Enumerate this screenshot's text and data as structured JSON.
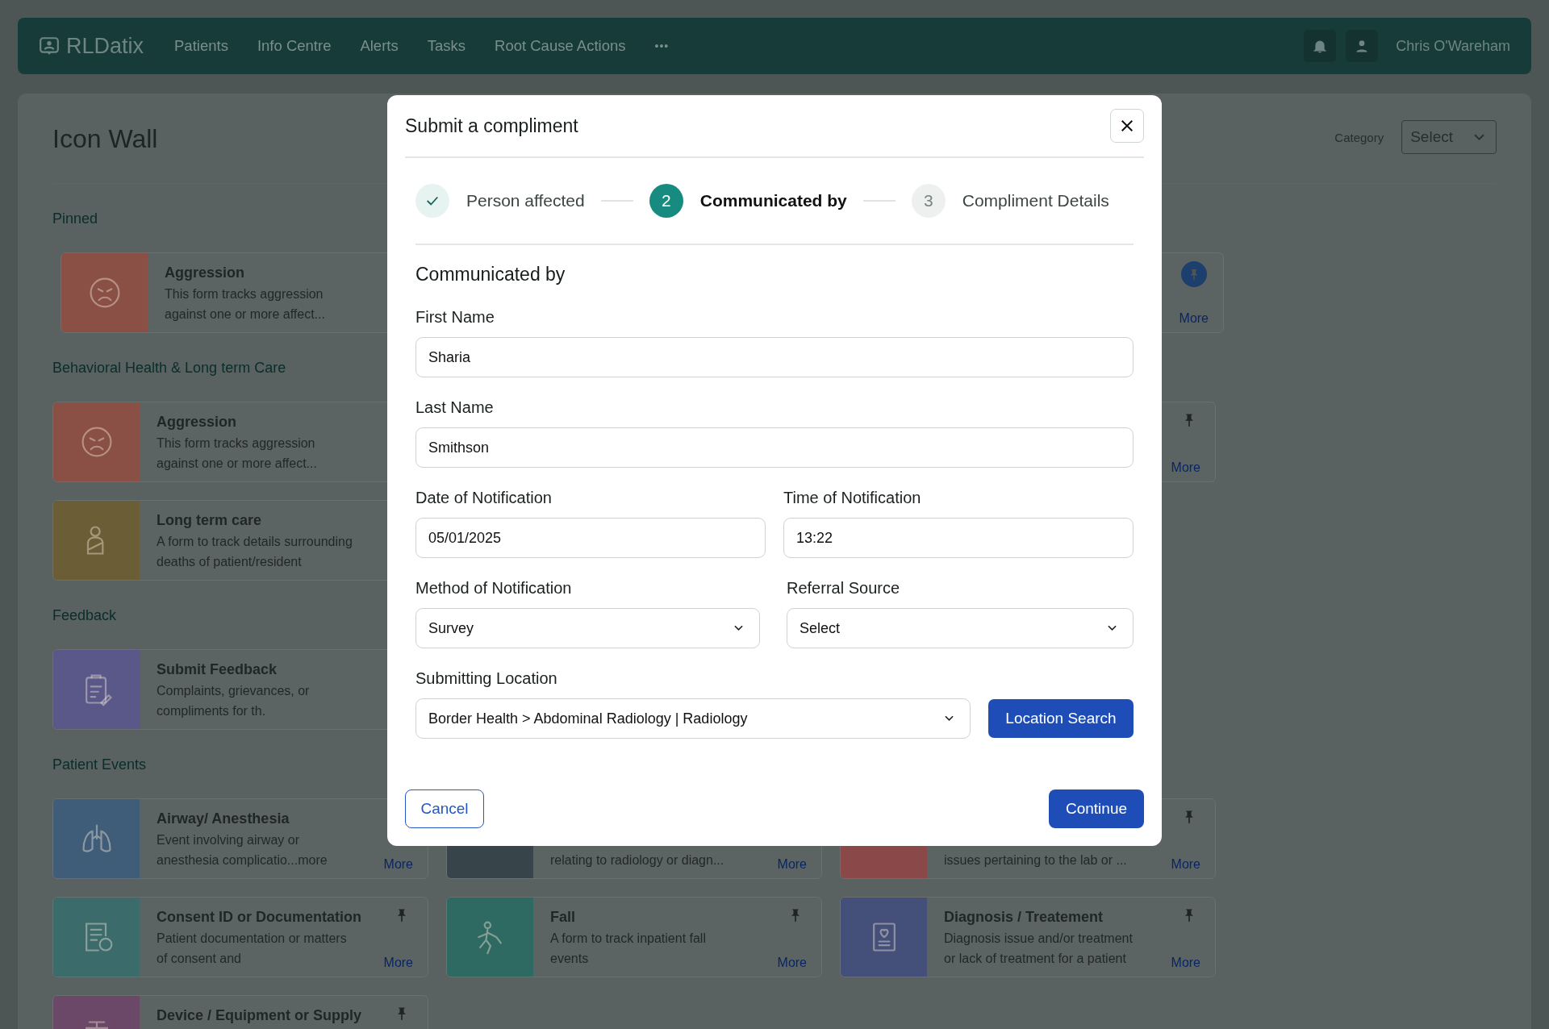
{
  "nav": {
    "brand": "RLDatix",
    "items": [
      "Patients",
      "Info Centre",
      "Alerts",
      "Tasks",
      "Root Cause Actions"
    ],
    "more": "•••",
    "user": "Chris O'Wareham"
  },
  "page": {
    "title": "Icon Wall",
    "category_label": "Category",
    "category_select": "Select",
    "sections": [
      {
        "title": "Pinned",
        "kind": "pinned",
        "cards": [
          {
            "title": "Aggression",
            "description": [
              "This form tracks aggression",
              "against one or more affect..."
            ],
            "color": "#8a4f45"
          },
          {
            "pinned": true,
            "more": "More"
          }
        ]
      },
      {
        "title": "Behavioral Health & Long term Care",
        "kind": "category",
        "cards": [
          {
            "title": "Aggression",
            "description": [
              "This form tracks aggression",
              "against one or more affect..."
            ],
            "color": "#8a4f45"
          },
          {
            "pinned": false,
            "more": "More"
          },
          {
            "title": "Long term care",
            "description": [
              "A form to track details surrounding",
              "deaths of patient/resident"
            ],
            "color": "#6b5e36"
          }
        ]
      },
      {
        "title": "Feedback",
        "kind": "category",
        "cards": [
          {
            "title": "Submit Feedback",
            "description": [
              "Complaints, grievances, or",
              "compliments for th."
            ],
            "color": "#5a5889"
          }
        ]
      },
      {
        "title": "Patient Events",
        "kind": "category",
        "cards": [
          {
            "title": "Airway/ Anesthesia",
            "description": [
              "Event involving airway or",
              "anesthesia complicatio...more"
            ],
            "color": "#3f5d78",
            "more": "More"
          },
          {
            "description": [
              "relating to radiology or diagn..."
            ],
            "color": "#37444a",
            "more": "More"
          },
          {
            "description": [
              "issues pertaining to the lab or ..."
            ],
            "color": "#8a4848",
            "pinned": false,
            "more": "More"
          },
          {
            "title": "Consent ID or Documentation",
            "description": [
              "Patient documentation or matters",
              "of consent and"
            ],
            "color": "#3c6b6c",
            "pinned": false,
            "more": "More"
          },
          {
            "title": "Fall",
            "description": [
              "A form to track inpatient fall",
              "events"
            ],
            "color": "#2f6a62",
            "pinned": false,
            "more": "More"
          },
          {
            "title": "Diagnosis / Treatement",
            "description": [
              "Diagnosis issue and/or treatment",
              "or lack of treatment for a patient"
            ],
            "color": "#44507a",
            "pinned": false,
            "more": "More"
          },
          {
            "title": "Device / Equipment or Supply",
            "color": "#6c4868",
            "pinned": false
          }
        ]
      }
    ]
  },
  "modal": {
    "title": "Submit a compliment",
    "steps": [
      {
        "label": "Person affected",
        "completed": true,
        "selected": false
      },
      {
        "label": "Communicated by",
        "number": "2",
        "completed": false,
        "selected": true
      },
      {
        "label": "Compliment Details",
        "number": "3",
        "completed": false,
        "selected": false
      }
    ],
    "section_title": "Communicated by",
    "form_rows": [
      [
        {
          "kind": "text",
          "label": "First Name",
          "value": "Sharia"
        }
      ],
      [
        {
          "kind": "text",
          "label": "Last Name",
          "value": "Smithson"
        }
      ],
      [
        {
          "kind": "text",
          "label": "Date of Notification",
          "value": "05/01/2025"
        },
        {
          "kind": "text",
          "label": "Time of Notification",
          "value": "13:22"
        }
      ],
      [
        {
          "kind": "select",
          "label": "Method of Notification",
          "value": "Survey"
        },
        {
          "kind": "select",
          "label": "Referral Source",
          "value": "Select"
        }
      ],
      [
        {
          "kind": "select",
          "label": "Submitting Location",
          "value": "Border Health > Abdominal Radiology | Radiology"
        },
        {
          "kind": "button",
          "label": "Location Search"
        }
      ]
    ],
    "cancel": "Cancel",
    "continue": "Continue"
  }
}
